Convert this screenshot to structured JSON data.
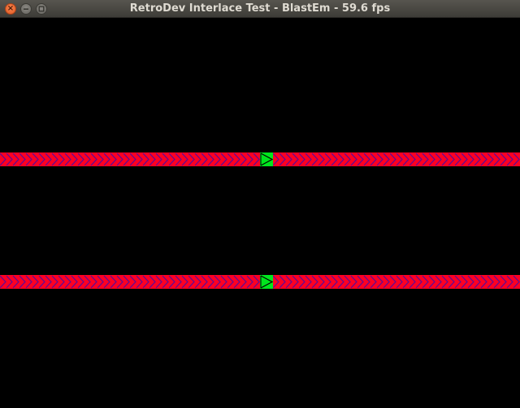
{
  "window": {
    "title": "RetroDev Interlace Test - BlastEm - 59.6 fps",
    "buttons": {
      "close_glyph": "×",
      "close_icon": "close-icon",
      "minimize_icon": "minimize-icon",
      "maximize_icon": "maximize-icon"
    }
  },
  "screen": {
    "background": "#000000",
    "stripe_color": "#ff0022",
    "chevron_color": "#6a0a8c",
    "sprite_color": "#00e61e",
    "sprite_outline": "#000000"
  }
}
